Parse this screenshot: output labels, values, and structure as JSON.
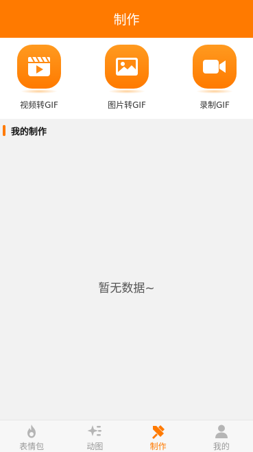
{
  "header": {
    "title": "制作"
  },
  "tools": [
    {
      "label": "视频转GIF",
      "icon": "clapperboard-play-icon"
    },
    {
      "label": "图片转GIF",
      "icon": "image-icon"
    },
    {
      "label": "录制GIF",
      "icon": "video-camera-icon"
    }
  ],
  "section": {
    "title": "我的制作"
  },
  "empty_state": {
    "text": "暂无数据~"
  },
  "tabbar": {
    "items": [
      {
        "label": "表情包",
        "icon": "flame-icon",
        "active": false
      },
      {
        "label": "动图",
        "icon": "sparkle-icon",
        "active": false
      },
      {
        "label": "制作",
        "icon": "tools-icon",
        "active": true
      },
      {
        "label": "我的",
        "icon": "person-icon",
        "active": false
      }
    ]
  },
  "colors": {
    "accent": "#ff7a00",
    "inactive": "#999999"
  }
}
